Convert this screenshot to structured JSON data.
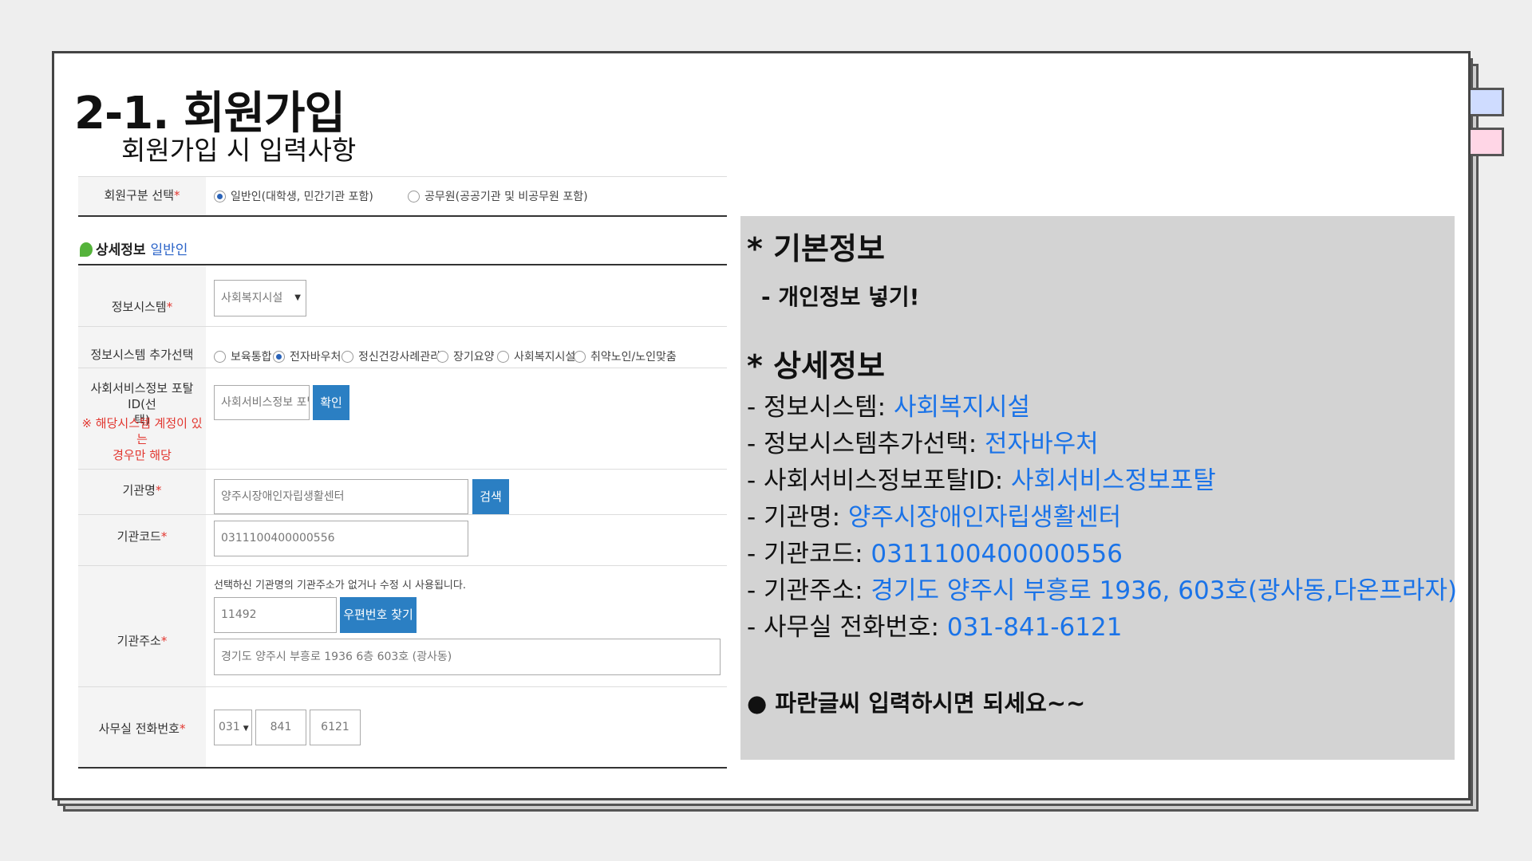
{
  "slide": {
    "title": "2-1. 회원가입",
    "subtitle": "회원가입 시 입력사항"
  },
  "form": {
    "member_type": {
      "label": "회원구분 선택",
      "req": "*",
      "options": [
        "일반인(대학생, 민간기관 포함)",
        "공무원(공공기관 및 비공무원 포함)"
      ],
      "selected": 0
    },
    "section": {
      "title": "상세정보",
      "subtitle": "일반인"
    },
    "info_system": {
      "label": "정보시스템",
      "req": "*",
      "value": "사회복지시설"
    },
    "info_system_extra": {
      "label": "정보시스템 추가선택",
      "options": [
        "보육통합",
        "전자바우처",
        "정신건강사례관리",
        "장기요양",
        "사회복지시설",
        "취약노인/노인맞춤"
      ],
      "selected": 1
    },
    "portal_id": {
      "label_1": "사회서비스정보 포탈 ID(선",
      "label_2": "택)",
      "note_1": "※ 해당시스템 계정이 있는",
      "note_2": "경우만 해당",
      "value": "사회서비스정보 포탈",
      "button": "확인"
    },
    "org_name": {
      "label": "기관명",
      "req": "*",
      "value": "양주시장애인자립생활센터",
      "button": "검색"
    },
    "org_code": {
      "label": "기관코드",
      "req": "*",
      "value": "0311100400000556"
    },
    "org_address": {
      "label": "기관주소",
      "req": "*",
      "notice": "선택하신 기관명의 기관주소가 없거나 수정 시 사용됩니다.",
      "zip": "11492",
      "zip_button": "우편번호 찾기",
      "address": "경기도 양주시 부흥로 1936 6층 603호 (광사동)"
    },
    "office_phone": {
      "label": "사무실 전화번호",
      "req": "*",
      "part1": "031",
      "part2": "841",
      "part3": "6121"
    }
  },
  "panel": {
    "heading_basic": "* 기본정보",
    "basic_note": "- 개인정보 넣기!",
    "heading_detail": "* 상세정보",
    "lines": [
      {
        "key": "- 정보시스템: ",
        "value": "사회복지시설"
      },
      {
        "key": "- 정보시스템추가선택: ",
        "value": "전자바우처"
      },
      {
        "key": "- 사회서비스정보포탈ID: ",
        "value": "사회서비스정보포탈"
      },
      {
        "key": "- 기관명: ",
        "value": "양주시장애인자립생활센터"
      },
      {
        "key": "- 기관코드: ",
        "value": "0311100400000556"
      },
      {
        "key": "- 기관주소: ",
        "value": "경기도 양주시 부흥로 1936, 603호(광사동,다온프라자)"
      },
      {
        "key": "- 사무실 전화번호: ",
        "value": "031-841-6121"
      }
    ],
    "bullet": "●  파란글씨 입력하시면 되세요~~"
  }
}
